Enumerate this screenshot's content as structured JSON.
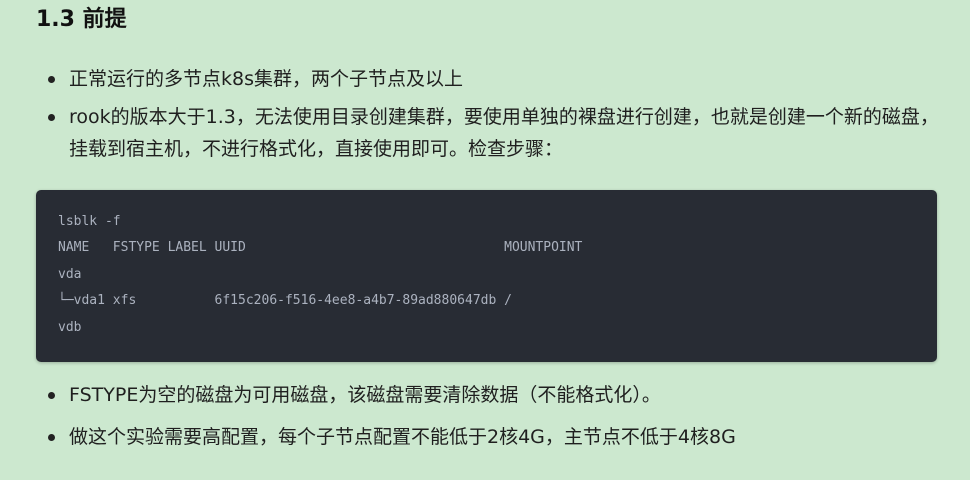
{
  "section": {
    "title": "1.3 前提"
  },
  "bullets_top": [
    "正常运行的多节点k8s集群，两个子节点及以上",
    "rook的版本大于1.3，无法使用目录创建集群，要使用单独的裸盘进行创建，也就是创建一个新的磁盘，挂载到宿主机，不进行格式化，直接使用即可。检查步骤："
  ],
  "code": {
    "lines": [
      "lsblk -f",
      "NAME   FSTYPE LABEL UUID                                 MOUNTPOINT",
      "vda",
      "└─vda1 xfs          6f15c206-f516-4ee8-a4b7-89ad880647db /",
      "vdb"
    ]
  },
  "bullets_bottom": [
    "FSTYPE为空的磁盘为可用磁盘，该磁盘需要清除数据（不能格式化）。",
    "做这个实验需要高配置，每个子节点配置不能低于2核4G，主节点不低于4核8G"
  ]
}
